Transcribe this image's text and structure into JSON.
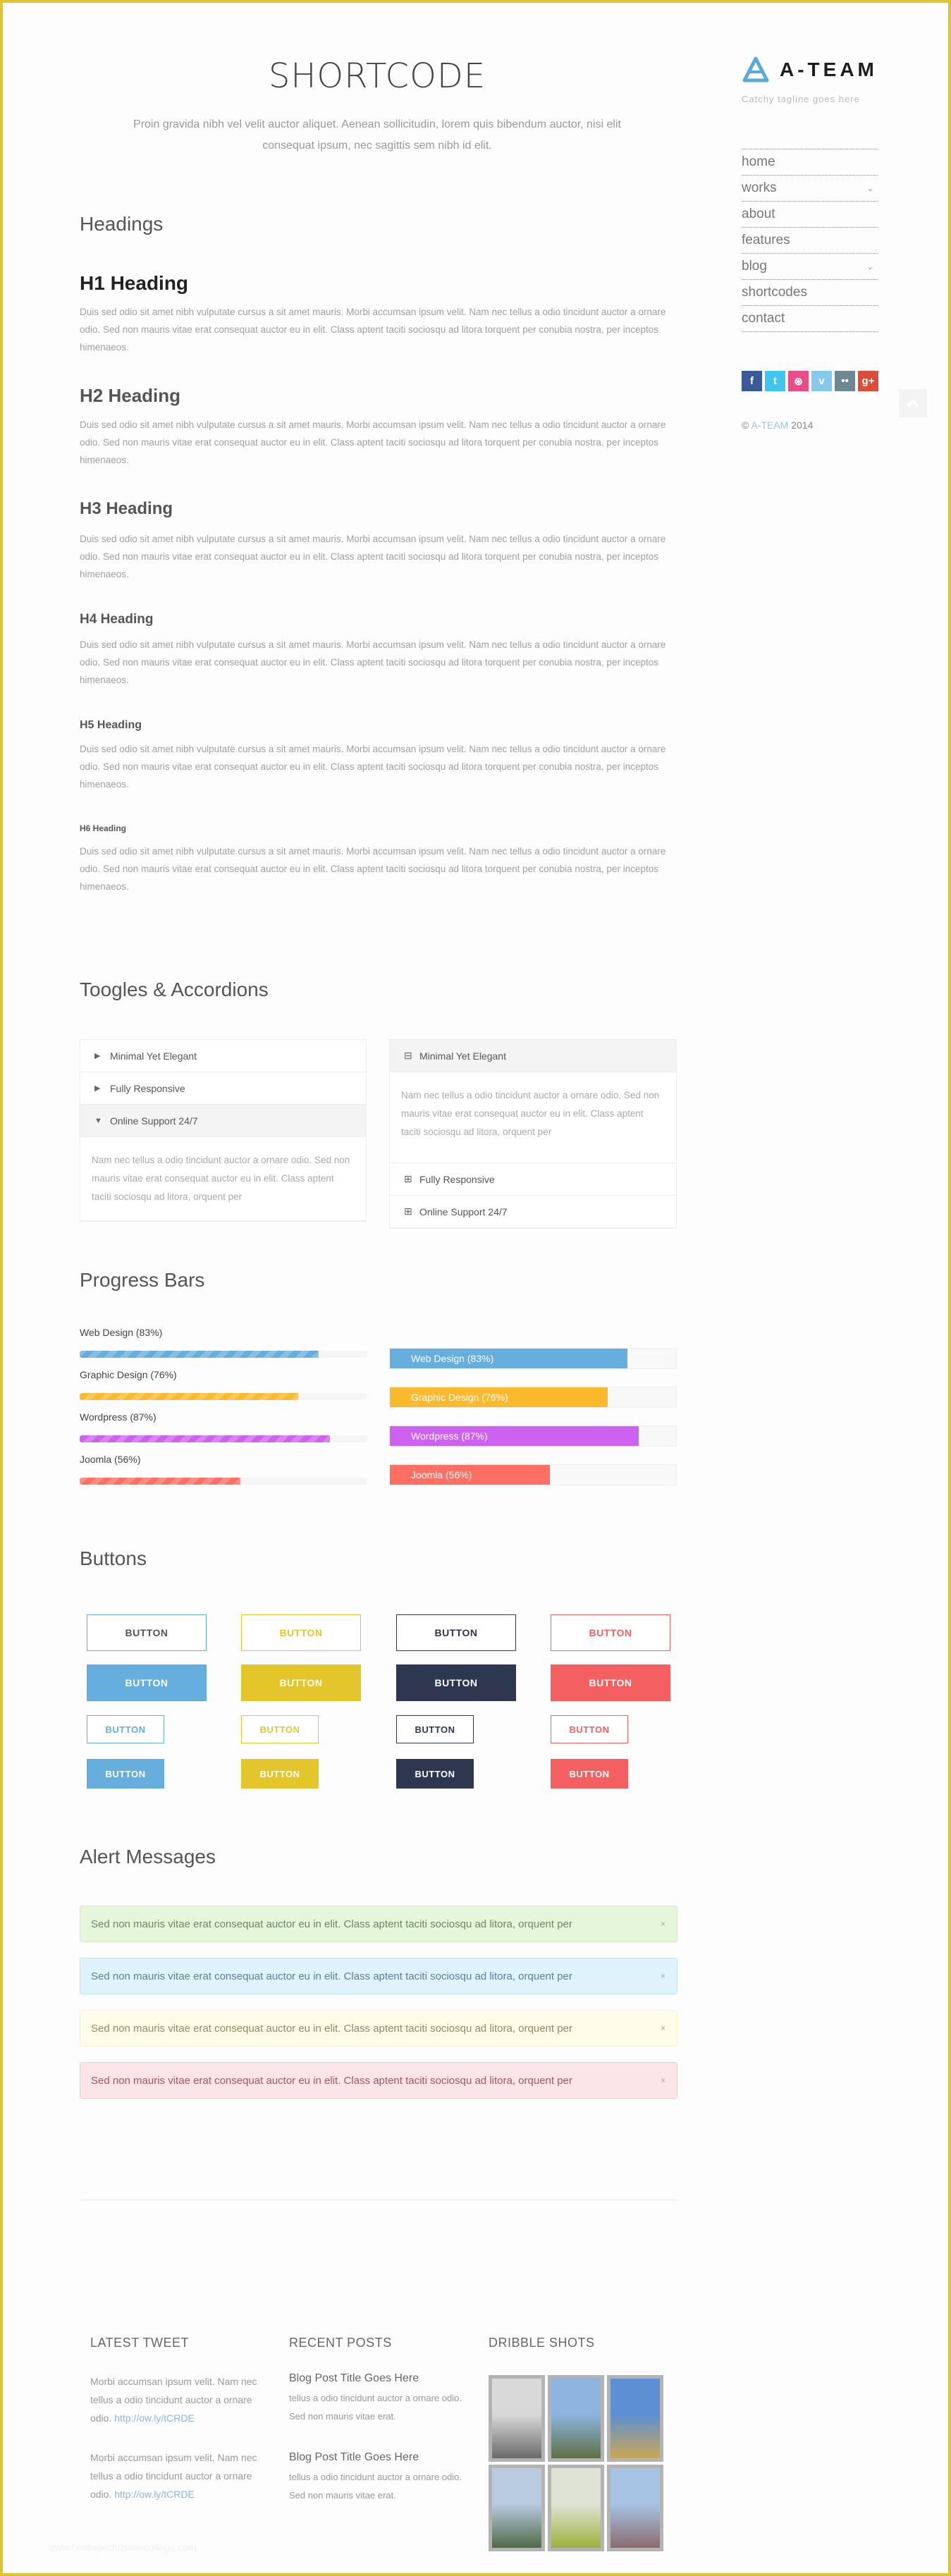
{
  "page": {
    "title": "SHORTCODE",
    "intro": "Proin gravida nibh vel velit auctor aliquet. Aenean sollicitudin, lorem quis bibendum auctor, nisi elit consequat ipsum, nec sagittis sem nibh id elit."
  },
  "sidebar": {
    "logo_text": "A-TEAM",
    "tagline": "Catchy tagline goes here",
    "nav": [
      {
        "label": "home",
        "has_submenu": false
      },
      {
        "label": "works",
        "has_submenu": true
      },
      {
        "label": "about",
        "has_submenu": false
      },
      {
        "label": "features",
        "has_submenu": false
      },
      {
        "label": "blog",
        "has_submenu": true
      },
      {
        "label": "shortcodes",
        "has_submenu": false
      },
      {
        "label": "contact",
        "has_submenu": false
      }
    ],
    "social": [
      {
        "name": "facebook",
        "glyph": "f",
        "color": "#3b5998"
      },
      {
        "name": "twitter",
        "glyph": "t",
        "color": "#40c4f0"
      },
      {
        "name": "dribbble",
        "glyph": "⊛",
        "color": "#ea4c89"
      },
      {
        "name": "vimeo",
        "glyph": "v",
        "color": "#86c9ef"
      },
      {
        "name": "flickr",
        "glyph": "••",
        "color": "#6d8891"
      },
      {
        "name": "google-plus",
        "glyph": "g+",
        "color": "#dd4b39"
      }
    ],
    "copyright_symbol": "©",
    "copyright_brand": "A-TEAM",
    "copyright_year": "2014",
    "back_to_top": "^"
  },
  "headings": {
    "section_title": "Headings",
    "items": [
      {
        "label": "H1 Heading",
        "text": "Duis sed odio sit amet nibh vulputate cursus a sit amet mauris. Morbi accumsan ipsum velit. Nam nec tellus a odio tincidunt auctor a ornare odio. Sed non mauris vitae erat consequat auctor eu in elit. Class aptent taciti sociosqu ad litora torquent per conubia nostra, per inceptos himenaeos."
      },
      {
        "label": "H2 Heading",
        "text": "Duis sed odio sit amet nibh vulputate cursus a sit amet mauris. Morbi accumsan ipsum velit. Nam nec tellus a odio tincidunt auctor a ornare odio. Sed non mauris vitae erat consequat auctor eu in elit. Class aptent taciti sociosqu ad litora torquent per conubia nostra, per inceptos himenaeos."
      },
      {
        "label": "H3 Heading",
        "text": "Duis sed odio sit amet nibh vulputate cursus a sit amet mauris. Morbi accumsan ipsum velit. Nam nec tellus a odio tincidunt auctor a ornare odio. Sed non mauris vitae erat consequat auctor eu in elit. Class aptent taciti sociosqu ad litora torquent per conubia nostra, per inceptos himenaeos."
      },
      {
        "label": "H4 Heading",
        "text": "Duis sed odio sit amet nibh vulputate cursus a sit amet mauris. Morbi accumsan ipsum velit. Nam nec tellus a odio tincidunt auctor a ornare odio. Sed non mauris vitae erat consequat auctor eu in elit. Class aptent taciti sociosqu ad litora torquent per conubia nostra, per inceptos himenaeos."
      },
      {
        "label": "H5 Heading",
        "text": "Duis sed odio sit amet nibh vulputate cursus a sit amet mauris. Morbi accumsan ipsum velit. Nam nec tellus a odio tincidunt auctor a ornare odio. Sed non mauris vitae erat consequat auctor eu in elit. Class aptent taciti sociosqu ad litora torquent per conubia nostra, per inceptos himenaeos."
      },
      {
        "label": "H6 Heading",
        "text": "Duis sed odio sit amet nibh vulputate cursus a sit amet mauris. Morbi accumsan ipsum velit. Nam nec tellus a odio tincidunt auctor a ornare odio. Sed non mauris vitae erat consequat auctor eu in elit. Class aptent taciti sociosqu ad litora torquent per conubia nostra, per inceptos himenaeos."
      }
    ]
  },
  "toggles": {
    "section_title": "Toogles & Accordions",
    "left": {
      "items": [
        "Minimal Yet Elegant",
        "Fully Responsive",
        "Online Support 24/7"
      ],
      "open_index": 2,
      "content": "Nam nec tellus a odio tincidunt auctor a ornare odio. Sed non mauris vitae erat consequat auctor eu in elit. Class aptent taciti sociosqu ad litora, orquent per"
    },
    "right": {
      "items": [
        "Minimal Yet Elegant",
        "Fully Responsive",
        "Online Support 24/7"
      ],
      "open_index": 0,
      "content": "Nam nec tellus a odio tincidunt auctor a ornare odio. Sed non mauris vitae erat consequat auctor eu in elit. Class aptent taciti sociosqu ad litora, orquent per"
    }
  },
  "progress": {
    "section_title": "Progress Bars",
    "bars": [
      {
        "label": "Web Design (83%)",
        "value": 83,
        "color": "#65aedd"
      },
      {
        "label": "Graphic Design (76%)",
        "value": 76,
        "color": "#fbb92e"
      },
      {
        "label": "Wordpress (87%)",
        "value": 87,
        "color": "#cd62f1"
      },
      {
        "label": "Joomla (56%)",
        "value": 56,
        "color": "#fe6f63"
      }
    ]
  },
  "buttons": {
    "section_title": "Buttons",
    "label": "BUTTON",
    "colors": [
      {
        "name": "blue",
        "color": "#65aedd",
        "outline_text": "#555"
      },
      {
        "name": "yellow",
        "color": "#e4c62b",
        "outline_text": "#e4c62b"
      },
      {
        "name": "navy",
        "color": "#2e3650",
        "outline_text": "#2e3650"
      },
      {
        "name": "red",
        "color": "#f46061",
        "outline_text": "#f46061"
      }
    ]
  },
  "alerts": {
    "section_title": "Alert Messages",
    "close": "×",
    "items": [
      {
        "type": "success",
        "text": "Sed non mauris vitae erat consequat auctor eu in elit. Class aptent taciti sociosqu ad litora, orquent per",
        "bg": "#e6f6da",
        "border": "#d6ecc6",
        "color": "#6b8a5a"
      },
      {
        "type": "info",
        "text": "Sed non mauris vitae erat consequat auctor eu in elit. Class aptent taciti sociosqu ad litora, orquent per",
        "bg": "#def3fc",
        "border": "#bfe6f5",
        "color": "#5a7f94"
      },
      {
        "type": "warning",
        "text": "Sed non mauris vitae erat consequat auctor eu in elit. Class aptent taciti sociosqu ad litora, orquent per",
        "bg": "#fefde9",
        "border": "#f6f1d1",
        "color": "#958a5d"
      },
      {
        "type": "danger",
        "text": "Sed non mauris vitae erat consequat auctor eu in elit. Class aptent taciti sociosqu ad litora, orquent per",
        "bg": "#fbe5e6",
        "border": "#f2cdd0",
        "color": "#a1575b"
      }
    ]
  },
  "footer": {
    "tweet_title": "LATEST TWEET",
    "tweets": [
      {
        "text": "Morbi accumsan ipsum velit. Nam nec tellus a odio tincidunt auctor a ornare odio.",
        "link": "http://ow.ly/tCRDE"
      },
      {
        "text": "Morbi accumsan ipsum velit. Nam nec tellus a odio tincidunt auctor a ornare odio.",
        "link": "http://ow.ly/tCRDE"
      }
    ],
    "posts_title": "RECENT POSTS",
    "posts": [
      {
        "title": "Blog Post Title Goes Here",
        "excerpt": "tellus a odio tincidunt auctor a ornare odio. Sed non mauris vitae erat."
      },
      {
        "title": "Blog Post Title Goes Here",
        "excerpt": "tellus a odio tincidunt auctor a ornare odio. Sed non mauris vitae erat."
      }
    ],
    "shots_title": "DRIBBLE SHOTS",
    "shots": [
      {
        "name": "pier-photo",
        "colors": [
          "#d9d9d9",
          "#6a6a6a"
        ]
      },
      {
        "name": "field-photo",
        "colors": [
          "#8db5dd",
          "#5e7046"
        ]
      },
      {
        "name": "relaxing-photo",
        "colors": [
          "#5d8fd4",
          "#c9a754"
        ]
      },
      {
        "name": "hikers-photo",
        "colors": [
          "#b8cbe0",
          "#4e6b45"
        ]
      },
      {
        "name": "valley-photo",
        "colors": [
          "#dfe3d6",
          "#9bb23a"
        ]
      },
      {
        "name": "railway-photo",
        "colors": [
          "#a7c3e4",
          "#8a6b6e"
        ]
      }
    ]
  },
  "watermark": "www.heritagechristiancollege.com"
}
